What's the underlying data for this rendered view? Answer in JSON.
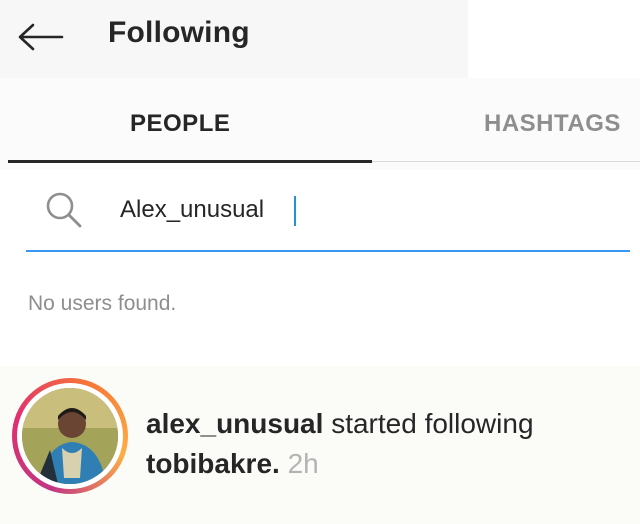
{
  "header": {
    "title": "Following",
    "back_icon": "arrow-left-icon"
  },
  "tabs": [
    {
      "label": "PEOPLE",
      "active": true
    },
    {
      "label": "HASHTAGS",
      "active": false
    }
  ],
  "search": {
    "value": "Alex_unusual",
    "icon": "search-icon"
  },
  "empty_message": "No users found.",
  "activity": {
    "username": "alex_unusual",
    "action": "started following",
    "target": "tobibakre.",
    "time": "2h"
  },
  "colors": {
    "accent": "#3897f0",
    "text": "#262626",
    "muted": "#8e8e8e",
    "ring_gradient": [
      "#c13584",
      "#e1306c",
      "#f77737",
      "#fcaf45"
    ]
  }
}
